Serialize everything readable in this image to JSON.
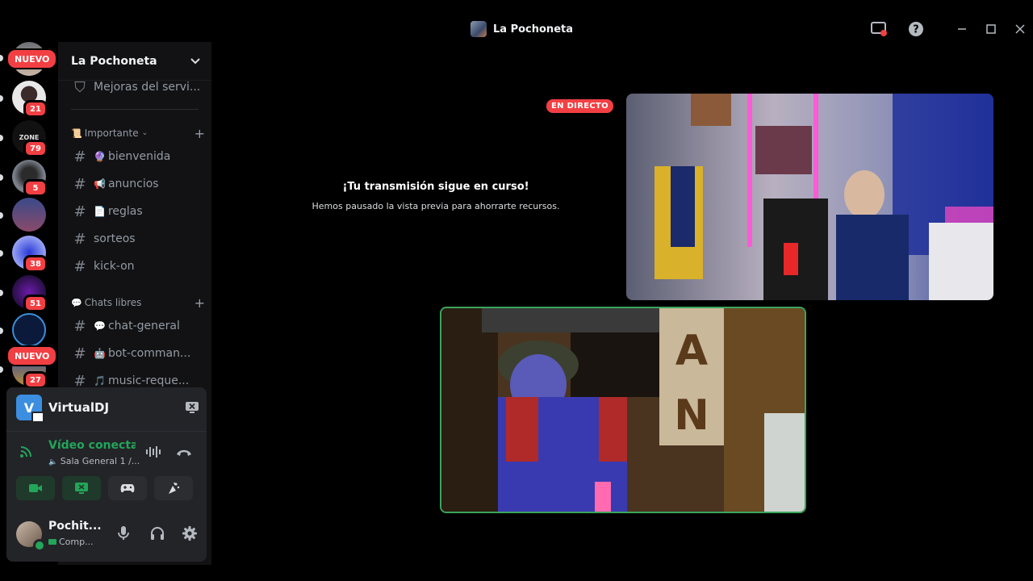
{
  "window": {
    "title": "La Pochoneta"
  },
  "rail": {
    "badges": [
      "NUEVO",
      "21",
      "79",
      "5",
      "38",
      "51",
      "NUEVO",
      "27"
    ],
    "server_text": [
      "ZONE"
    ]
  },
  "server": {
    "name": "La Pochoneta",
    "channels_top": [
      {
        "label": "Mejoras del servi..."
      }
    ],
    "categories": [
      {
        "name": "Importante",
        "channels": [
          {
            "emoji": "🔮",
            "label": "bienvenida"
          },
          {
            "emoji": "📢",
            "label": "anuncios"
          },
          {
            "emoji": "📄",
            "label": "reglas"
          },
          {
            "emoji": "",
            "label": "sorteos"
          },
          {
            "emoji": "",
            "label": "kick-on"
          }
        ]
      },
      {
        "name": "Chats libres",
        "channels": [
          {
            "emoji": "💬",
            "label": "chat-general"
          },
          {
            "emoji": "🤖",
            "label": "bot-comman..."
          },
          {
            "emoji": "🎵",
            "label": "music-reque..."
          }
        ]
      }
    ]
  },
  "panel": {
    "app_name": "VirtualDJ",
    "voice_status": "Vídeo conectado",
    "voice_room": "Sala General 1 /...",
    "user_name": "Pochit...",
    "user_status": "Comp..."
  },
  "stage": {
    "live_badge": "EN DIRECTO",
    "paused_title": "¡Tu transmisión sigue en curso!",
    "paused_subtitle": "Hemos pausado la vista previa para ahorrarte recursos."
  },
  "colors": {
    "accent_green": "#23a55a",
    "badge_red": "#f23f43",
    "sidebar_bg": "#121214",
    "panel_bg": "#232428"
  },
  "icons": [
    "screen-share-icon",
    "help-icon",
    "minimize-icon",
    "maximize-icon",
    "close-icon",
    "chevron-down-icon",
    "shield-icon",
    "hash-icon",
    "plus-icon",
    "signal-icon",
    "soundboard-icon",
    "disconnect-icon",
    "camera-icon",
    "share-screen-icon",
    "activity-icon",
    "effects-icon",
    "mic-icon",
    "headphones-icon",
    "gear-icon"
  ]
}
